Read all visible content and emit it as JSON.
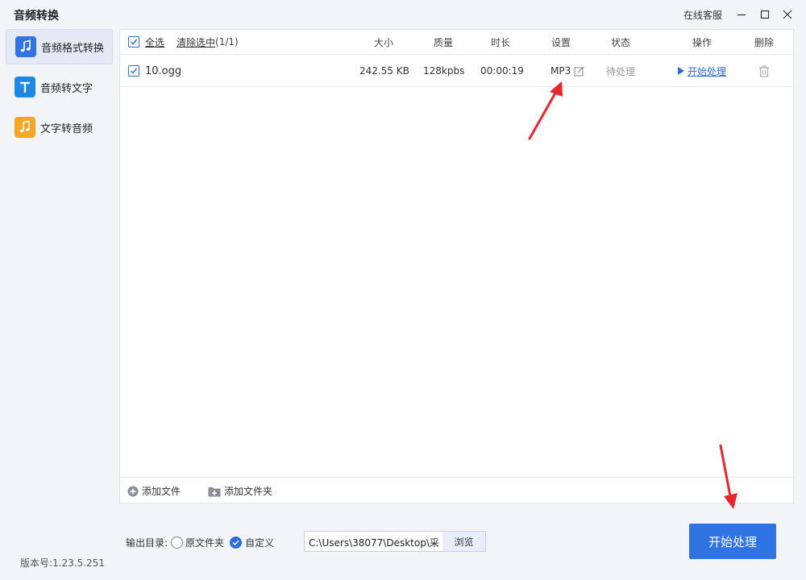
{
  "window": {
    "title": "音频转换",
    "support_label": "在线客服"
  },
  "sidebar": {
    "items": [
      {
        "label": "音频格式转换",
        "icon": "music-note-icon",
        "active": true
      },
      {
        "label": "音频转文字",
        "icon": "text-t-icon",
        "active": false
      },
      {
        "label": "文字转音频",
        "icon": "music-note-icon",
        "active": false
      }
    ],
    "version": "版本号:1.23.5.251"
  },
  "table": {
    "select_all_label": "全选",
    "clear_selection_label": "清除选中",
    "selection_count": "(1/1)",
    "columns": [
      "大小",
      "质量",
      "时长",
      "设置",
      "状态",
      "操作",
      "删除"
    ],
    "rows": [
      {
        "checked": true,
        "filename": "10.ogg",
        "size": "242.55 KB",
        "quality": "128kpbs",
        "duration": "00:00:19",
        "format": "MP3",
        "status": "待处理",
        "action": "开始处理"
      }
    ]
  },
  "footer": {
    "add_file_label": "添加文件",
    "add_folder_label": "添加文件夹"
  },
  "output": {
    "label": "输出目录:",
    "option_original": "原文件夹",
    "option_custom": "自定义",
    "selected": "custom",
    "path": "C:\\Users\\38077\\Desktop\\采",
    "browse_label": "浏览"
  },
  "start_button_label": "开始处理",
  "colors": {
    "accent": "#2f74e2",
    "arrow": "#e8262b"
  }
}
